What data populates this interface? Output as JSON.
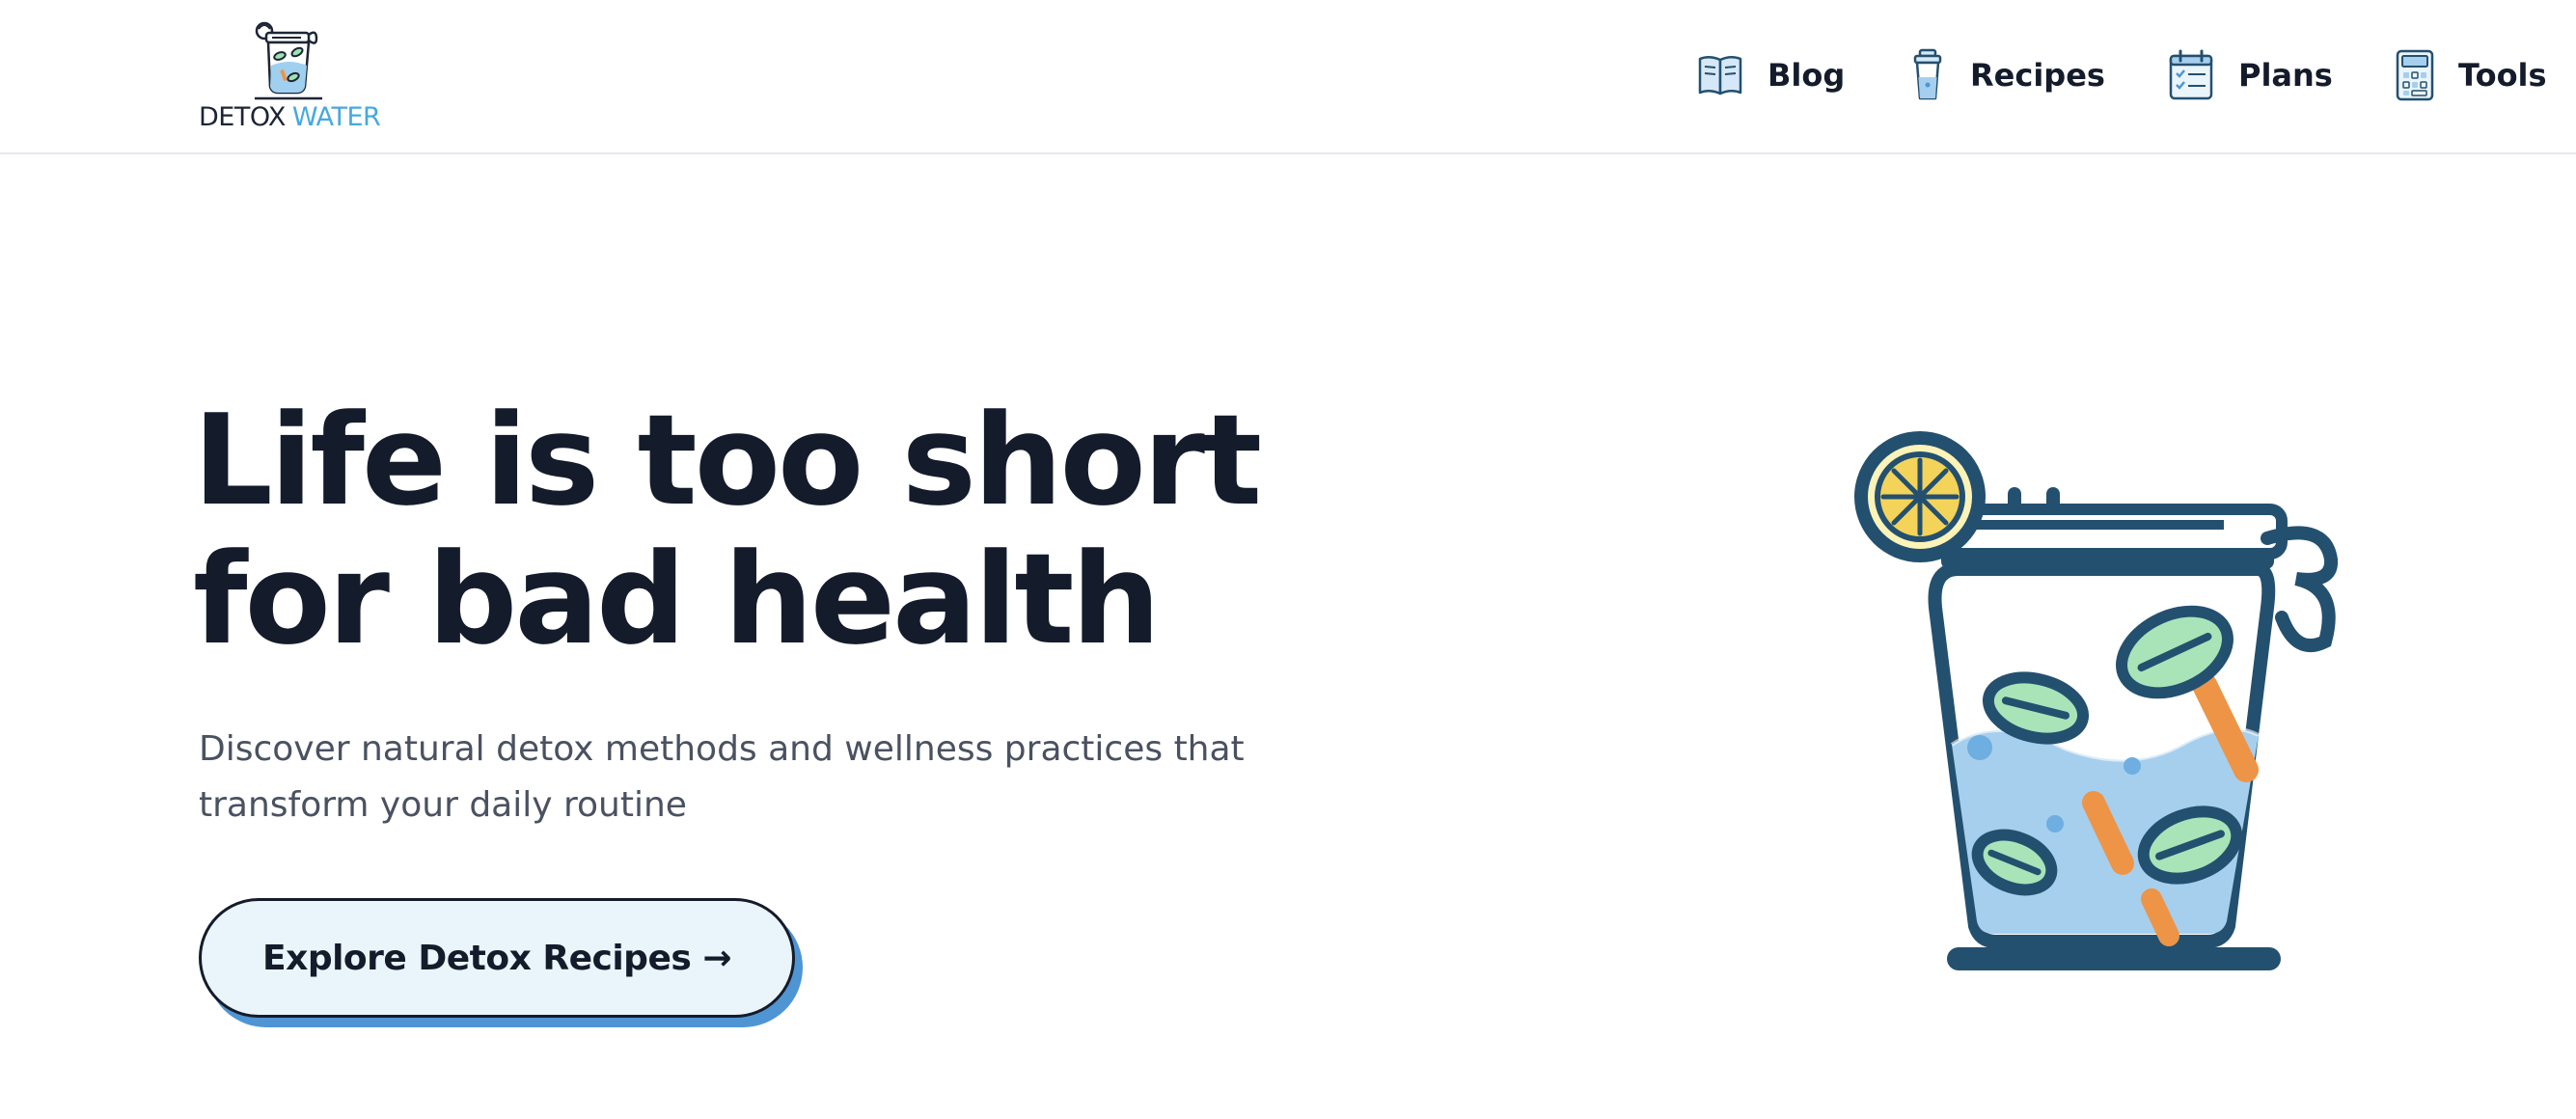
{
  "brand": {
    "name_part1": "DETOX",
    "name_part2": "WATER"
  },
  "nav": {
    "items": [
      {
        "label": "Blog",
        "icon": "book-icon"
      },
      {
        "label": "Recipes",
        "icon": "cup-icon"
      },
      {
        "label": "Plans",
        "icon": "calendar-checklist-icon"
      },
      {
        "label": "Tools",
        "icon": "calculator-icon"
      }
    ]
  },
  "hero": {
    "title_line1": "Life is too short",
    "title_line2": "for bad health",
    "subtitle": "Discover natural detox methods and wellness practices that transform your daily routine",
    "cta_label": "Explore Detox Recipes →"
  },
  "colors": {
    "text_dark": "#141b2b",
    "brand_blue": "#47a9dc",
    "cta_bg": "#eaf4fb",
    "cta_shadow": "#4f95d3",
    "jar_outline": "#24506f",
    "water": "#a6cfee",
    "cucumber": "#a8e4b8",
    "carrot": "#ee9446",
    "lemon": "#f3d35a"
  }
}
